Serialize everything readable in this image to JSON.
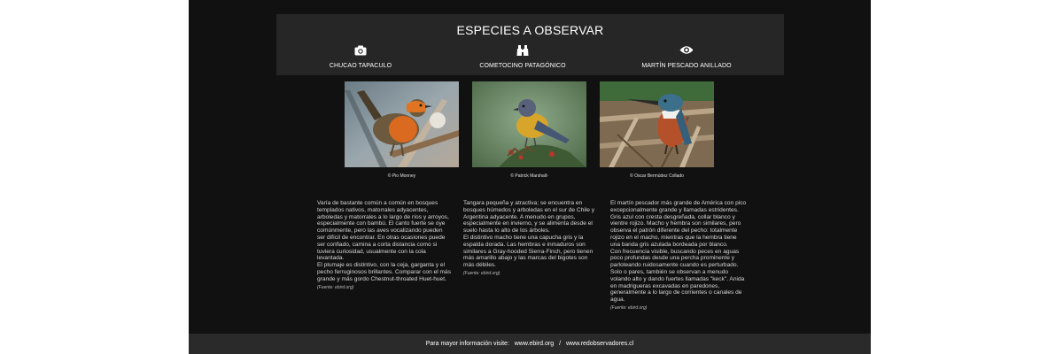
{
  "header": {
    "title": "ESPECIES A OBSERVAR",
    "columns": [
      {
        "icon": "camera-icon",
        "label": "CHUCAO TAPACULO"
      },
      {
        "icon": "binoculars-icon",
        "label": "COMETOCINO PATAGÓNICO"
      },
      {
        "icon": "eye-icon",
        "label": "MARTÍN PESCADO ANILLADO"
      }
    ]
  },
  "species": [
    {
      "photo_credit": "© Pio Monney",
      "paragraphs": [
        "Varía de bastante común a común en bosques templados nativos, matorrales adyacentes, arboledas y matorrales a lo largo de ríos y arroyos, especialmente con bambú. El canto fuerte se oye comúnmente, pero las aves vocalizando pueden ser difícil de encontrar. En otras ocasiones puede ser confiado, camina a corta distancia como si tuviera curiosidad, usualmente con la cola levantada.",
        "El plumaje es distintivo, con la ceja, garganta y el pecho ferruginosos brillantes. Comparar con el más grande y más gordo Chestnut-throated Huet-huet."
      ],
      "source": "(Fuente: ebird.org)"
    },
    {
      "photo_credit": "© Patrick Marshall›",
      "paragraphs": [
        "Tangara pequeña y atractiva; se encuentra en bosques húmedos y arboledas en el sur de Chile y Argentina adyacente. A menudo en grupos, especialmente en invierno, y se alimenta desde el suelo hasta lo alto de los árboles.",
        "El distintivo macho tiene una capucha gris y la espalda dorada. Las hembras e inmaduros son similares a Gray-hooded Sierra-Finch, pero tienen más amarillo abajo y las marcas del bigotes son más débiles."
      ],
      "source": "(Fuente: ebird.org)"
    },
    {
      "photo_credit": "© Oscar Bermúdez Collado",
      "paragraphs": [
        "El martín pescador más grande de América con pico excepcionalmente grande y llamadas estridentes. Gris azul con cresta desgreñada, collar blanco y vientre rojizo. Macho y hembra son similares, pero observa el patrón diferente del pecho: totalmente rojizo en el macho, mientras que la hembra tiene una banda gris azulada bordeada por blanco.",
        "Con frecuencia visible, buscando peces en aguas poco profundas desde una percha prominente y parloteando ruidosamente cuando es perturbado. Solo o pares, también se observan a menudo volando alto y dando fuertes llamadas \"keck\". Anida en madrigueras excavadas en paredones, generalmente a lo largo de corrientes o canales de agua."
      ],
      "source": "(Fuente: ebird.org)"
    }
  ],
  "footer": {
    "prefix": "Para mayor información visite:",
    "link1": "www.ebird.org",
    "separator": "/",
    "link2": "www.redobservadores.cl"
  },
  "colors": {
    "page_background": "#111111",
    "header_background": "#262626",
    "footer_background": "#2a2a2a"
  }
}
